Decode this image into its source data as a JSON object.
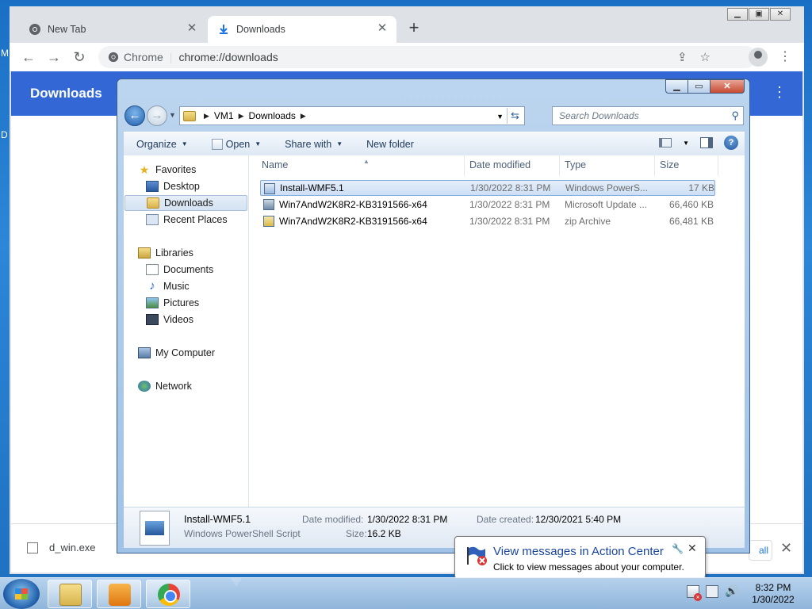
{
  "desktop": {
    "edge_letter_1": "M",
    "edge_letter_2": "D"
  },
  "chrome": {
    "tabs": [
      {
        "label": "New Tab"
      },
      {
        "label": "Downloads"
      }
    ],
    "omnibox": {
      "site": "Chrome",
      "url": "chrome://downloads"
    },
    "page_header": {
      "title": "Downloads"
    },
    "shelf": {
      "item_name": "d_win.exe",
      "show_all_label": "all"
    }
  },
  "explorer": {
    "address": {
      "segments": [
        "VM1",
        "Downloads"
      ]
    },
    "search": {
      "placeholder": "Search Downloads"
    },
    "commands": {
      "organize": "Organize",
      "open": "Open",
      "share_with": "Share with",
      "new_folder": "New folder"
    },
    "nav": {
      "favorites": "Favorites",
      "desktop": "Desktop",
      "downloads": "Downloads",
      "recent_places": "Recent Places",
      "libraries": "Libraries",
      "documents": "Documents",
      "music": "Music",
      "pictures": "Pictures",
      "videos": "Videos",
      "my_computer": "My Computer",
      "network": "Network"
    },
    "columns": {
      "name": "Name",
      "date": "Date modified",
      "type": "Type",
      "size": "Size"
    },
    "files": [
      {
        "name": "Install-WMF5.1",
        "date": "1/30/2022 8:31 PM",
        "type": "Windows PowerS...",
        "size": "17 KB"
      },
      {
        "name": "Win7AndW2K8R2-KB3191566-x64",
        "date": "1/30/2022 8:31 PM",
        "type": "Microsoft Update ...",
        "size": "66,460 KB"
      },
      {
        "name": "Win7AndW2K8R2-KB3191566-x64",
        "date": "1/30/2022 8:31 PM",
        "type": "zip Archive",
        "size": "66,481 KB"
      }
    ],
    "details": {
      "name": "Install-WMF5.1",
      "type": "Windows PowerShell Script",
      "date_modified_label": "Date modified:",
      "date_modified": "1/30/2022 8:31 PM",
      "size_label": "Size:",
      "size": "16.2 KB",
      "date_created_label": "Date created:",
      "date_created": "12/30/2021 5:40 PM"
    }
  },
  "balloon": {
    "title": "View messages in Action Center",
    "body": "Click to view messages about your computer."
  },
  "taskbar": {
    "clock": {
      "time": "8:32 PM",
      "date": "1/30/2022"
    }
  }
}
